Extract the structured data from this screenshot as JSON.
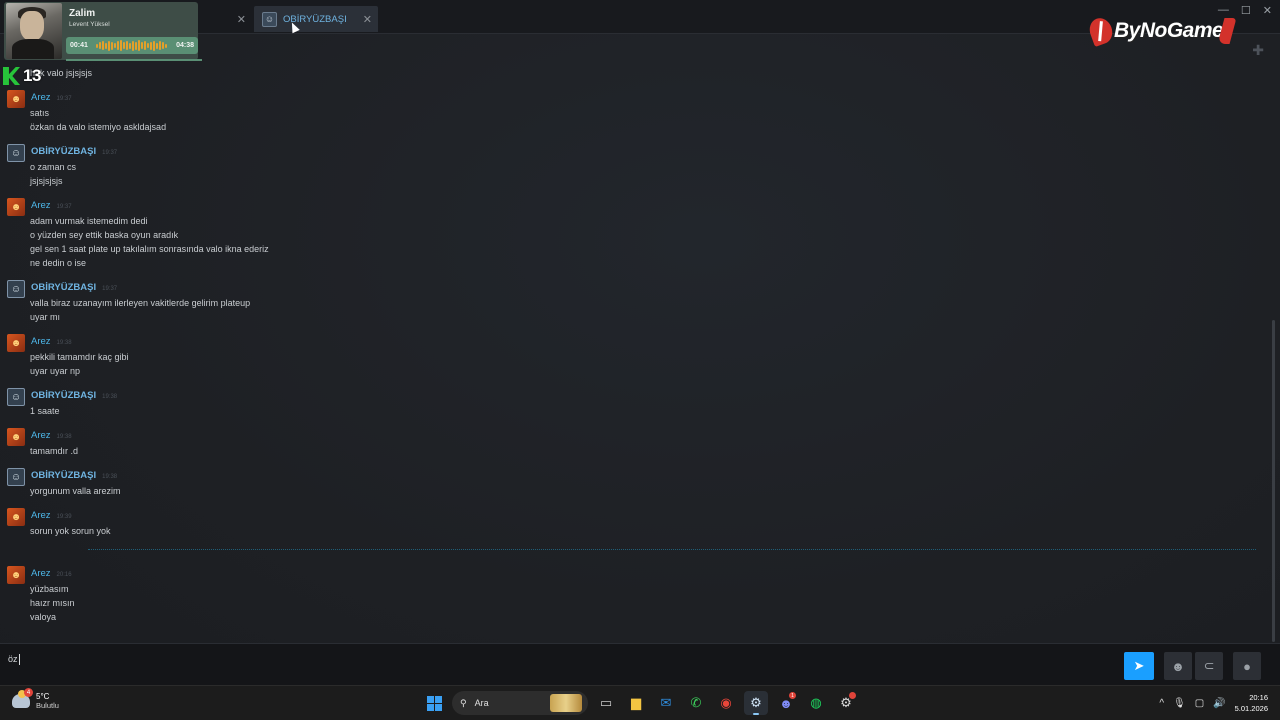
{
  "tabs": [
    {
      "label": "Zalim",
      "active": false
    },
    {
      "label": "OBİRYÜZBAŞI",
      "active": true
    }
  ],
  "music": {
    "title": "Zalim",
    "artist": "Levent Yüksel",
    "elapsed": "00:41",
    "total": "04:38"
  },
  "rating": {
    "number": "13"
  },
  "logo": {
    "text": "ByNoGame"
  },
  "messages": [
    {
      "author": "OBİRYÜZBAŞI",
      "type": "obir",
      "time": "",
      "lines": [
        "hak valo jsjsjsjs"
      ]
    },
    {
      "author": "Arez",
      "type": "arez",
      "time": "19:37",
      "lines": [
        "satıs",
        "özkan da valo istemiyo askldajsad"
      ]
    },
    {
      "author": "OBİRYÜZBAŞI",
      "type": "obir",
      "time": "19:37",
      "lines": [
        "o zaman cs",
        "jsjsjsjsjs"
      ]
    },
    {
      "author": "Arez",
      "type": "arez",
      "time": "19:37",
      "lines": [
        "adam vurmak istemedim dedi",
        "o yüzden sey ettik baska oyun aradık",
        "gel sen 1 saat plate up takılalım sonrasında valo ikna ederiz",
        "ne dedin o ise"
      ]
    },
    {
      "author": "OBİRYÜZBAŞI",
      "type": "obir",
      "time": "19:37",
      "lines": [
        "valla biraz uzanayım ilerleyen vakitlerde gelirim plateup",
        "uyar mı"
      ]
    },
    {
      "author": "Arez",
      "type": "arez",
      "time": "19:38",
      "lines": [
        "pekkili tamamdır kaç gibi",
        "uyar uyar np"
      ]
    },
    {
      "author": "OBİRYÜZBAŞI",
      "type": "obir",
      "time": "19:38",
      "lines": [
        "1 saate"
      ]
    },
    {
      "author": "Arez",
      "type": "arez",
      "time": "19:38",
      "lines": [
        "tamamdır .d"
      ]
    },
    {
      "author": "OBİRYÜZBAŞI",
      "type": "obir",
      "time": "19:38",
      "lines": [
        "yorgunum valla arezim"
      ]
    },
    {
      "author": "Arez",
      "type": "arez",
      "time": "19:39",
      "lines": [
        "sorun yok sorun yok"
      ]
    },
    {
      "author": "Arez",
      "type": "arez",
      "time": "20:16",
      "lines": [
        "yüzbasım",
        "haızr mısın",
        "valoya"
      ]
    }
  ],
  "composer": {
    "value": "öz"
  },
  "taskbar": {
    "weather_temp": "5°C",
    "weather_cond": "Bulutlu",
    "search_label": "Ara",
    "time": "20:16",
    "date": "5.01.2026",
    "discord_badge": "1"
  }
}
